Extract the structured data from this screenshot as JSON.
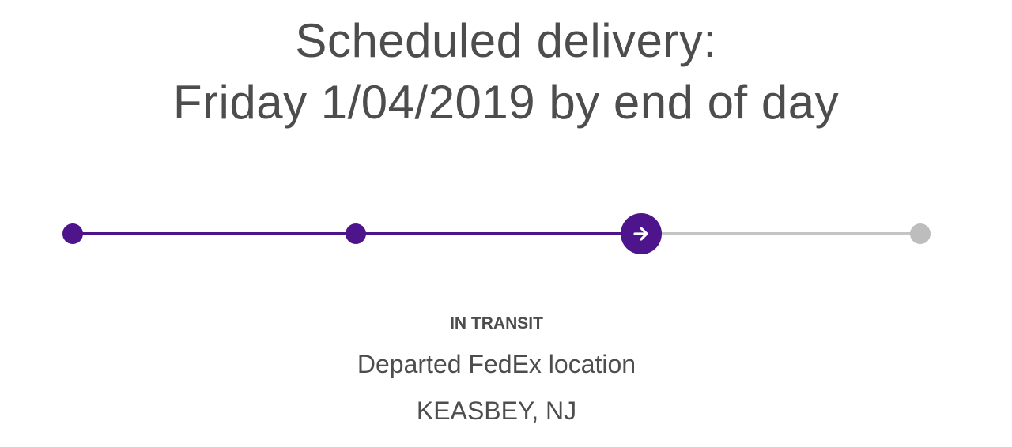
{
  "delivery": {
    "heading_line1": "Scheduled delivery:",
    "heading_line2": "Friday 1/04/2019 by end of day"
  },
  "progress": {
    "steps": [
      {
        "state": "complete"
      },
      {
        "state": "complete"
      },
      {
        "state": "current",
        "icon": "arrow-right-icon"
      },
      {
        "state": "pending"
      }
    ],
    "completed_steps": 3,
    "total_steps": 4,
    "colors": {
      "complete": "#4d148c",
      "pending": "#bdbdbd",
      "pending_track": "#c4c4c4"
    }
  },
  "status": {
    "label": "IN TRANSIT",
    "description": "Departed FedEx location",
    "location": "KEASBEY, NJ"
  }
}
